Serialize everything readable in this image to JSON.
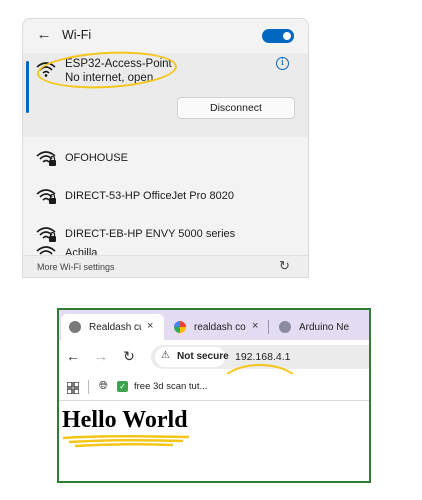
{
  "wifi": {
    "title": "Wi-Fi",
    "toggle_on": true,
    "connected": {
      "name": "ESP32-Access-Point",
      "status": "No internet, open",
      "disconnect_label": "Disconnect",
      "info_glyph": "i"
    },
    "networks": [
      {
        "name": "OFOHOUSE",
        "icon": "wifi-secured-icon"
      },
      {
        "name": "DIRECT-53-HP OfficeJet Pro 8020",
        "icon": "wifi-secured-icon"
      },
      {
        "name": "DIRECT-EB-HP ENVY 5000 series",
        "icon": "wifi-secured-icon"
      },
      {
        "name": "Achilla",
        "icon": "wifi-secured-icon"
      }
    ],
    "footer": {
      "more_label": "More Wi-Fi settings",
      "refresh_glyph": "↻"
    },
    "accent_color": "#0067c0"
  },
  "browser": {
    "tabs": [
      {
        "title": "Realdash cu",
        "favicon": "realdash-icon",
        "close": "×",
        "active": true
      },
      {
        "title": "realdash co",
        "favicon": "google-icon",
        "close": "×",
        "active": false
      },
      {
        "title": "Arduino Ne",
        "favicon": "arduino-forum-icon",
        "close": "×",
        "active": false
      }
    ],
    "security_label": "Not secure",
    "url": "192.168.4.1",
    "bookmark": {
      "label": "free 3d scan tut..."
    },
    "content": {
      "heading": "Hello World"
    },
    "frame_color": "#2e7d32",
    "highlight_color": "#f5c518"
  }
}
